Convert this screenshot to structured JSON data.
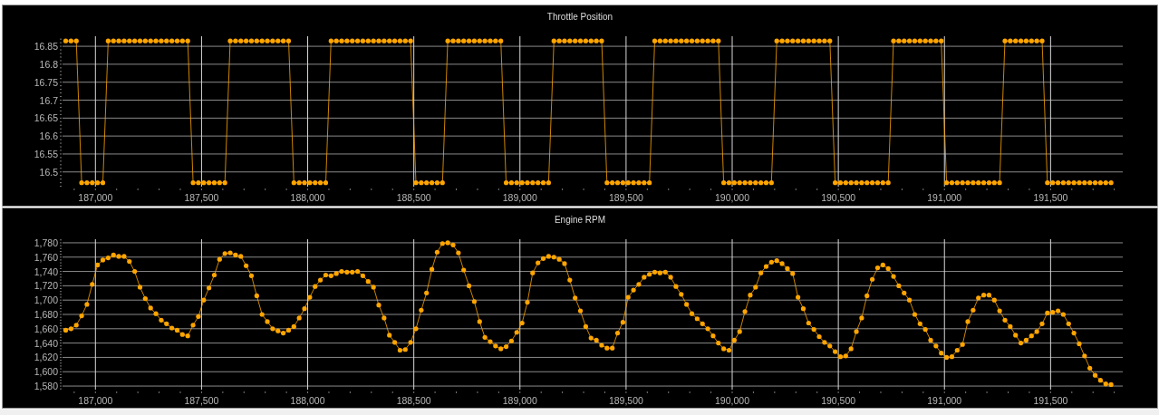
{
  "charts": [
    {
      "chart_data": {
        "type": "line",
        "title": "Throttle Position",
        "x": [
          186860,
          186885,
          186910,
          186935,
          186960,
          186985,
          187010,
          187035,
          187060,
          187085,
          187110,
          187135,
          187160,
          187185,
          187210,
          187235,
          187260,
          187285,
          187310,
          187335,
          187360,
          187385,
          187410,
          187435,
          187460,
          187485,
          187510,
          187535,
          187560,
          187585,
          187610,
          187635,
          187660,
          187685,
          187710,
          187735,
          187760,
          187785,
          187810,
          187835,
          187860,
          187885,
          187910,
          187935,
          187960,
          187985,
          188010,
          188035,
          188060,
          188085,
          188110,
          188135,
          188160,
          188185,
          188210,
          188235,
          188260,
          188285,
          188310,
          188335,
          188360,
          188385,
          188410,
          188435,
          188460,
          188485,
          188510,
          188535,
          188560,
          188585,
          188610,
          188635,
          188660,
          188685,
          188710,
          188735,
          188760,
          188785,
          188810,
          188835,
          188860,
          188885,
          188910,
          188935,
          188960,
          188985,
          189010,
          189035,
          189060,
          189085,
          189110,
          189135,
          189160,
          189185,
          189210,
          189235,
          189260,
          189285,
          189310,
          189335,
          189360,
          189385,
          189410,
          189435,
          189460,
          189485,
          189510,
          189535,
          189560,
          189585,
          189610,
          189635,
          189660,
          189685,
          189710,
          189735,
          189760,
          189785,
          189810,
          189835,
          189860,
          189885,
          189910,
          189935,
          189960,
          189985,
          190010,
          190035,
          190060,
          190085,
          190110,
          190135,
          190160,
          190185,
          190210,
          190235,
          190260,
          190285,
          190310,
          190335,
          190360,
          190385,
          190410,
          190435,
          190460,
          190485,
          190510,
          190535,
          190560,
          190585,
          190610,
          190635,
          190660,
          190685,
          190710,
          190735,
          190760,
          190785,
          190810,
          190835,
          190860,
          190885,
          190910,
          190935,
          190960,
          190985,
          191010,
          191035,
          191060,
          191085,
          191110,
          191135,
          191160,
          191185,
          191210,
          191235,
          191260,
          191285,
          191310,
          191335,
          191360,
          191385,
          191410,
          191435,
          191460,
          191485,
          191510,
          191535,
          191560,
          191585,
          191610,
          191635,
          191660,
          191685,
          191710,
          191735,
          191760,
          191785
        ],
        "series": [
          {
            "color": "#ffa500",
            "values": [
              16.865,
              16.865,
              16.865,
              16.47,
              16.47,
              16.47,
              16.47,
              16.47,
              16.865,
              16.865,
              16.865,
              16.865,
              16.865,
              16.865,
              16.865,
              16.865,
              16.865,
              16.865,
              16.865,
              16.865,
              16.865,
              16.865,
              16.865,
              16.865,
              16.47,
              16.47,
              16.47,
              16.47,
              16.47,
              16.47,
              16.47,
              16.865,
              16.865,
              16.865,
              16.865,
              16.865,
              16.865,
              16.865,
              16.865,
              16.865,
              16.865,
              16.865,
              16.865,
              16.47,
              16.47,
              16.47,
              16.47,
              16.47,
              16.47,
              16.47,
              16.865,
              16.865,
              16.865,
              16.865,
              16.865,
              16.865,
              16.865,
              16.865,
              16.865,
              16.865,
              16.865,
              16.865,
              16.865,
              16.865,
              16.865,
              16.865,
              16.47,
              16.47,
              16.47,
              16.47,
              16.47,
              16.47,
              16.865,
              16.865,
              16.865,
              16.865,
              16.865,
              16.865,
              16.865,
              16.865,
              16.865,
              16.865,
              16.865,
              16.47,
              16.47,
              16.47,
              16.47,
              16.47,
              16.47,
              16.47,
              16.47,
              16.47,
              16.865,
              16.865,
              16.865,
              16.865,
              16.865,
              16.865,
              16.865,
              16.865,
              16.865,
              16.865,
              16.47,
              16.47,
              16.47,
              16.47,
              16.47,
              16.47,
              16.47,
              16.47,
              16.47,
              16.865,
              16.865,
              16.865,
              16.865,
              16.865,
              16.865,
              16.865,
              16.865,
              16.865,
              16.865,
              16.865,
              16.865,
              16.865,
              16.47,
              16.47,
              16.47,
              16.47,
              16.47,
              16.47,
              16.47,
              16.47,
              16.47,
              16.47,
              16.865,
              16.865,
              16.865,
              16.865,
              16.865,
              16.865,
              16.865,
              16.865,
              16.865,
              16.865,
              16.865,
              16.47,
              16.47,
              16.47,
              16.47,
              16.47,
              16.47,
              16.47,
              16.47,
              16.47,
              16.47,
              16.47,
              16.865,
              16.865,
              16.865,
              16.865,
              16.865,
              16.865,
              16.865,
              16.865,
              16.865,
              16.865,
              16.47,
              16.47,
              16.47,
              16.47,
              16.47,
              16.47,
              16.47,
              16.47,
              16.47,
              16.47,
              16.47,
              16.865,
              16.865,
              16.865,
              16.865,
              16.865,
              16.865,
              16.865,
              16.865,
              16.47,
              16.47,
              16.47,
              16.47,
              16.47,
              16.47,
              16.47,
              16.47,
              16.47,
              16.47,
              16.47,
              16.47,
              16.47
            ]
          }
        ],
        "xlim": [
          186845,
          191840
        ],
        "ylim": [
          16.459,
          16.878
        ],
        "xticks": [
          {
            "value": 187000,
            "label": "187,000"
          },
          {
            "value": 187500,
            "label": "187,500"
          },
          {
            "value": 188000,
            "label": "188,000"
          },
          {
            "value": 188500,
            "label": "188,500"
          },
          {
            "value": 189000,
            "label": "189,000"
          },
          {
            "value": 189500,
            "label": "189,500"
          },
          {
            "value": 190000,
            "label": "190,000"
          },
          {
            "value": 190500,
            "label": "190,500"
          },
          {
            "value": 191000,
            "label": "191,000"
          },
          {
            "value": 191500,
            "label": "191,500"
          }
        ],
        "yticks": [
          16.5,
          16.55,
          16.6,
          16.65,
          16.7,
          16.75,
          16.8,
          16.85
        ],
        "grid": true
      }
    },
    {
      "chart_data": {
        "type": "line",
        "title": "Engine RPM",
        "x": [
          186860,
          186885,
          186910,
          186935,
          186960,
          186985,
          187010,
          187035,
          187060,
          187085,
          187110,
          187135,
          187160,
          187185,
          187210,
          187235,
          187260,
          187285,
          187310,
          187335,
          187360,
          187385,
          187410,
          187435,
          187460,
          187485,
          187510,
          187535,
          187560,
          187585,
          187610,
          187635,
          187660,
          187685,
          187710,
          187735,
          187760,
          187785,
          187810,
          187835,
          187860,
          187885,
          187910,
          187935,
          187960,
          187985,
          188010,
          188035,
          188060,
          188085,
          188110,
          188135,
          188160,
          188185,
          188210,
          188235,
          188260,
          188285,
          188310,
          188335,
          188360,
          188385,
          188410,
          188435,
          188460,
          188485,
          188510,
          188535,
          188560,
          188585,
          188610,
          188635,
          188660,
          188685,
          188710,
          188735,
          188760,
          188785,
          188810,
          188835,
          188860,
          188885,
          188910,
          188935,
          188960,
          188985,
          189010,
          189035,
          189060,
          189085,
          189110,
          189135,
          189160,
          189185,
          189210,
          189235,
          189260,
          189285,
          189310,
          189335,
          189360,
          189385,
          189410,
          189435,
          189460,
          189485,
          189510,
          189535,
          189560,
          189585,
          189610,
          189635,
          189660,
          189685,
          189710,
          189735,
          189760,
          189785,
          189810,
          189835,
          189860,
          189885,
          189910,
          189935,
          189960,
          189985,
          190010,
          190035,
          190060,
          190085,
          190110,
          190135,
          190160,
          190185,
          190210,
          190235,
          190260,
          190285,
          190310,
          190335,
          190360,
          190385,
          190410,
          190435,
          190460,
          190485,
          190510,
          190535,
          190560,
          190585,
          190610,
          190635,
          190660,
          190685,
          190710,
          190735,
          190760,
          190785,
          190810,
          190835,
          190860,
          190885,
          190910,
          190935,
          190960,
          190985,
          191010,
          191035,
          191060,
          191085,
          191110,
          191135,
          191160,
          191185,
          191210,
          191235,
          191260,
          191285,
          191310,
          191335,
          191360,
          191385,
          191410,
          191435,
          191460,
          191485,
          191510,
          191535,
          191560,
          191585,
          191610,
          191635,
          191660,
          191685,
          191710,
          191735,
          191760,
          191785
        ],
        "series": [
          {
            "color": "#ffa500",
            "values": [
              1658,
              1660,
              1665,
              1678,
              1694,
              1722,
              1749,
              1756,
              1759,
              1763,
              1761,
              1761,
              1754,
              1740,
              1718,
              1702,
              1689,
              1681,
              1672,
              1667,
              1661,
              1658,
              1652,
              1650,
              1665,
              1677,
              1700,
              1717,
              1735,
              1757,
              1765,
              1766,
              1763,
              1761,
              1748,
              1734,
              1706,
              1680,
              1670,
              1660,
              1657,
              1654,
              1658,
              1663,
              1675,
              1688,
              1704,
              1719,
              1728,
              1735,
              1734,
              1737,
              1740,
              1739,
              1739,
              1740,
              1734,
              1726,
              1718,
              1693,
              1675,
              1651,
              1641,
              1630,
              1631,
              1641,
              1660,
              1686,
              1710,
              1743,
              1767,
              1779,
              1780,
              1777,
              1766,
              1742,
              1720,
              1698,
              1670,
              1648,
              1642,
              1636,
              1632,
              1635,
              1643,
              1655,
              1668,
              1697,
              1738,
              1752,
              1758,
              1761,
              1760,
              1757,
              1751,
              1728,
              1703,
              1685,
              1663,
              1647,
              1644,
              1637,
              1633,
              1633,
              1654,
              1669,
              1704,
              1714,
              1722,
              1732,
              1736,
              1739,
              1738,
              1739,
              1732,
              1719,
              1708,
              1694,
              1681,
              1674,
              1667,
              1660,
              1650,
              1640,
              1632,
              1630,
              1644,
              1656,
              1684,
              1707,
              1718,
              1738,
              1747,
              1753,
              1755,
              1751,
              1744,
              1737,
              1704,
              1688,
              1668,
              1659,
              1649,
              1641,
              1636,
              1628,
              1621,
              1622,
              1632,
              1656,
              1675,
              1706,
              1729,
              1745,
              1749,
              1744,
              1733,
              1720,
              1710,
              1700,
              1680,
              1667,
              1659,
              1644,
              1636,
              1626,
              1620,
              1621,
              1630,
              1638,
              1670,
              1686,
              1703,
              1707,
              1707,
              1700,
              1685,
              1672,
              1663,
              1651,
              1640,
              1644,
              1650,
              1656,
              1667,
              1682,
              1683,
              1685,
              1680,
              1667,
              1654,
              1639,
              1622,
              1605,
              1595,
              1588,
              1583,
              1582
            ]
          }
        ],
        "xlim": [
          186845,
          191840
        ],
        "ylim": [
          1575,
          1785
        ],
        "xticks": [
          {
            "value": 187000,
            "label": "187,000"
          },
          {
            "value": 187500,
            "label": "187,500"
          },
          {
            "value": 188000,
            "label": "188,000"
          },
          {
            "value": 188500,
            "label": "188,500"
          },
          {
            "value": 189000,
            "label": "189,000"
          },
          {
            "value": 189500,
            "label": "189,500"
          },
          {
            "value": 190000,
            "label": "190,000"
          },
          {
            "value": 190500,
            "label": "190,500"
          },
          {
            "value": 191000,
            "label": "191,000"
          },
          {
            "value": 191500,
            "label": "191,500"
          }
        ],
        "yticks": [
          {
            "value": 1580,
            "label": "1,580"
          },
          {
            "value": 1600,
            "label": "1,600"
          },
          {
            "value": 1620,
            "label": "1,620"
          },
          {
            "value": 1640,
            "label": "1,640"
          },
          {
            "value": 1660,
            "label": "1,660"
          },
          {
            "value": 1680,
            "label": "1,680"
          },
          {
            "value": 1700,
            "label": "1,700"
          },
          {
            "value": 1720,
            "label": "1,720"
          },
          {
            "value": 1740,
            "label": "1,740"
          },
          {
            "value": 1760,
            "label": "1,760"
          },
          {
            "value": 1780,
            "label": "1,780"
          }
        ],
        "grid": true
      }
    }
  ]
}
